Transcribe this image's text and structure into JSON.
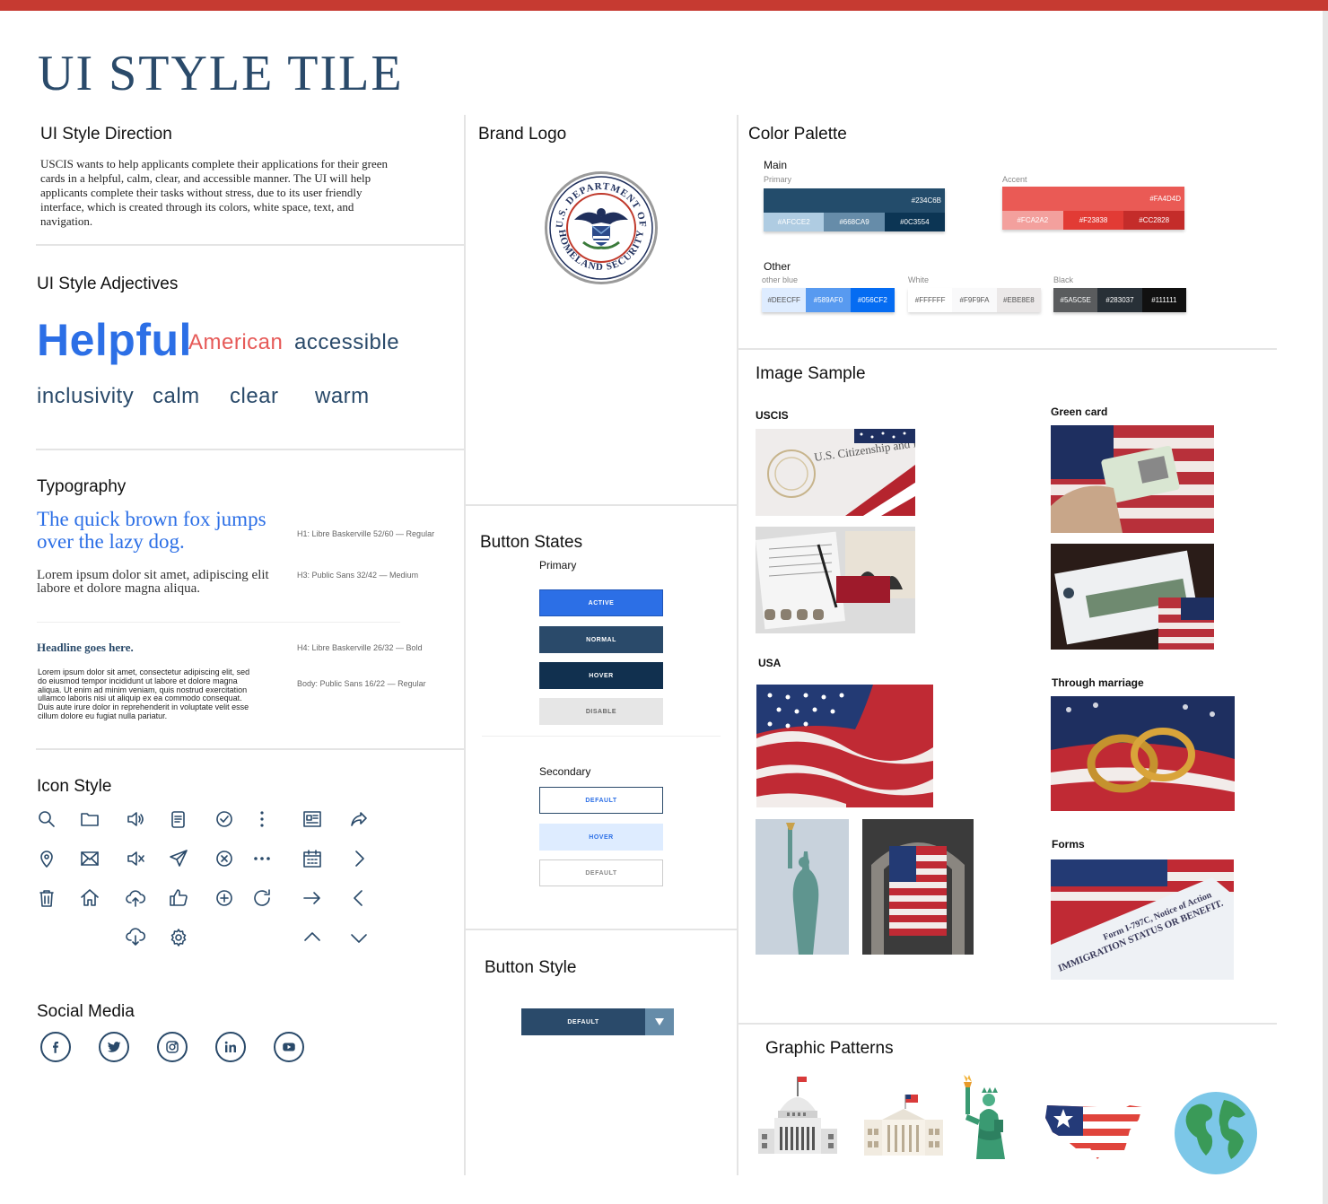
{
  "page": {
    "title": "UI STYLE TILE"
  },
  "direction": {
    "heading": "UI Style Direction",
    "text": "USCIS wants to help applicants complete their applications for their green cards in a helpful, calm, clear, and accessible manner. The UI will help applicants complete their tasks without stress, due to its user friendly interface, which is created through its colors, white space, text, and navigation."
  },
  "adjectives": {
    "heading": "UI Style Adjectives",
    "words": [
      "Helpful",
      "American",
      "accessible",
      "inclusivity",
      "calm",
      "clear",
      "warm"
    ]
  },
  "typography": {
    "heading": "Typography",
    "h1_sample": "The quick brown fox jumps over the lazy dog.",
    "h1_spec": "H1: Libre Baskerville 52/60 — Regular",
    "h3_sample": "Lorem ipsum dolor sit amet, adipiscing elit labore et dolore magna aliqua.",
    "h3_spec": "H3: Public Sans 32/42 — Medium",
    "h4_sample": "Headline goes here.",
    "h4_spec": "H4: Libre Baskerville 26/32 — Bold",
    "body_sample": "Lorem ipsum dolor sit amet, consectetur adipiscing elit, sed do eiusmod tempor incididunt ut labore et dolore magna aliqua. Ut enim ad minim veniam, quis nostrud exercitation ullamco laboris nisi ut aliquip ex ea commodo consequat. Duis aute irure dolor in reprehenderit in voluptate velit esse cillum dolore eu fugiat nulla pariatur.",
    "body_spec": "Body: Public Sans 16/22 — Regular"
  },
  "icons": {
    "heading": "Icon Style",
    "names": [
      "search-icon",
      "folder-icon",
      "volume-icon",
      "document-icon",
      "check-circle-icon",
      "more-vertical-icon",
      "news-icon",
      "share-icon",
      "location-icon",
      "mail-icon",
      "mute-icon",
      "send-icon",
      "close-circle-icon",
      "more-horizontal-icon",
      "calendar-icon",
      "chevron-right-icon",
      "trash-icon",
      "home-icon",
      "upload-cloud-icon",
      "thumbs-up-icon",
      "add-circle-icon",
      "refresh-icon",
      "arrow-right-icon",
      "chevron-left-icon",
      "download-cloud-icon",
      "settings-icon",
      "chevron-up-icon",
      "chevron-down-icon"
    ]
  },
  "social": {
    "heading": "Social Media",
    "names": [
      "facebook-icon",
      "twitter-icon",
      "instagram-icon",
      "linkedin-icon",
      "youtube-icon"
    ]
  },
  "logo": {
    "heading": "Brand Logo",
    "ring_top": "U.S. DEPARTMENT OF",
    "ring_bottom": "HOMELAND SECURITY"
  },
  "buttons": {
    "heading": "Button States",
    "primary_label": "Primary",
    "primary": [
      "ACTIVE",
      "NORMAL",
      "HOVER",
      "DISABLE"
    ],
    "secondary_label": "Secondary",
    "secondary": [
      "DEFAULT",
      "HOVER",
      "DEFAULT"
    ]
  },
  "button_style": {
    "heading": "Button Style",
    "label": "DEFAULT"
  },
  "colors": {
    "heading": "Color Palette",
    "main_label": "Main",
    "primary_label": "Primary",
    "primary_main": "#234C6B",
    "primary_shades": [
      "#AFCCE2",
      "#668CA9",
      "#0C3554"
    ],
    "accent_label": "Accent",
    "accent_main": "#FA4D4D",
    "accent_shades": [
      "#FCA2A2",
      "#F23838",
      "#CC2828"
    ],
    "other_label": "Other",
    "otherblue_label": "other blue",
    "otherblue": [
      "#DEECFF",
      "#589AF0",
      "#056CF2"
    ],
    "white_label": "White",
    "white": [
      "#FFFFFF",
      "#F9F9FA",
      "#EBE8E8"
    ],
    "black_label": "Black",
    "black": [
      "#5A5C5E",
      "#283037",
      "#111111"
    ]
  },
  "images": {
    "heading": "Image Sample",
    "uscis": "USCIS",
    "green_card": "Green card",
    "usa": "USA",
    "marriage": "Through marriage",
    "forms": "Forms",
    "photo_text_uscis": "U.S. Citizenship and Immigration Services",
    "photo_text_form": "Form I-797C, Notice of Action",
    "photo_text_status": "IMMIGRATION STATUS OR BENEFIT."
  },
  "patterns": {
    "heading": "Graphic Patterns"
  }
}
